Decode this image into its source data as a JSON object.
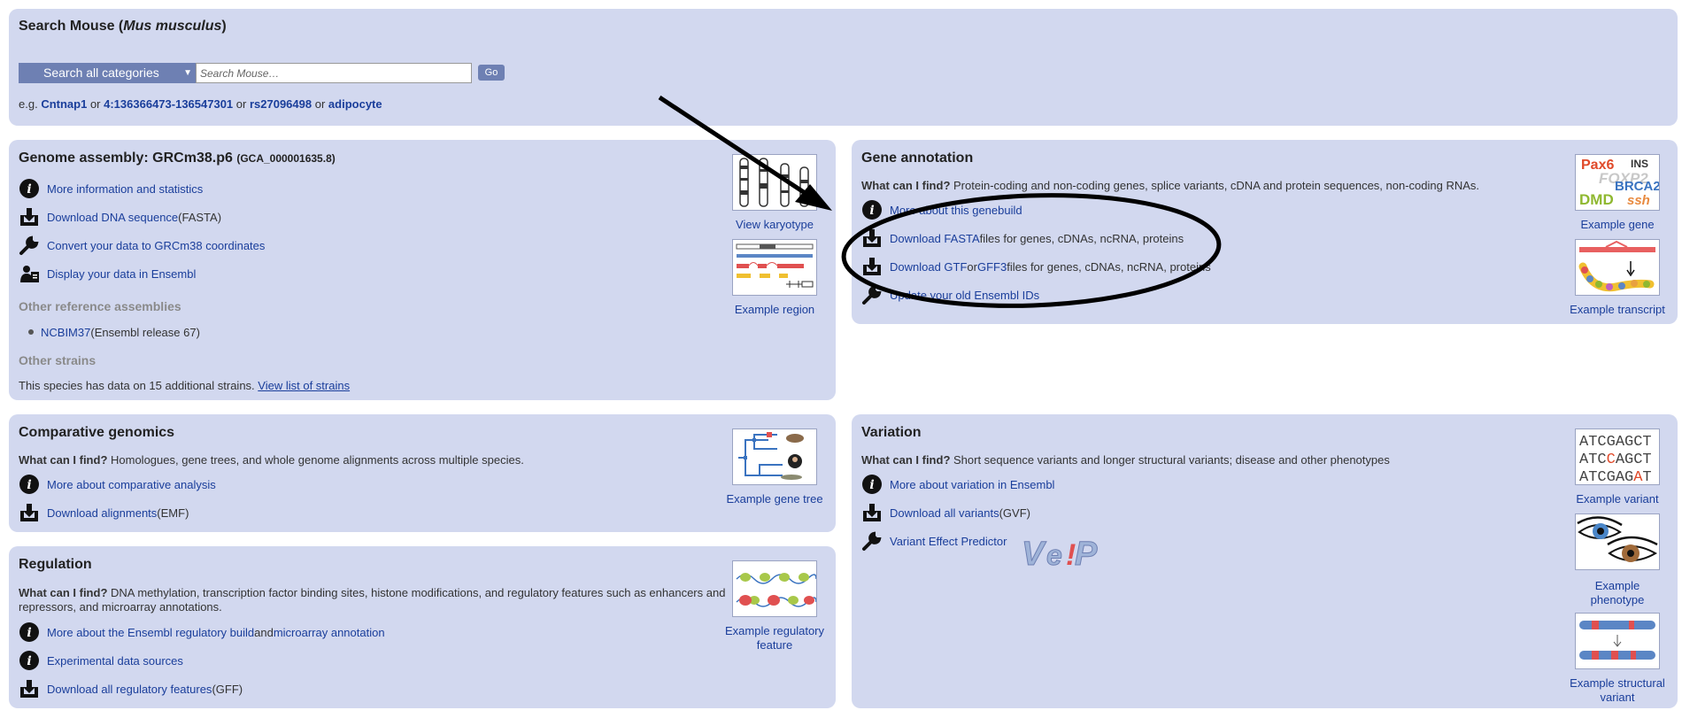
{
  "search": {
    "title_prefix": "Search Mouse (",
    "title_species": "Mus musculus",
    "title_suffix": ")",
    "category_label": "Search all categories",
    "placeholder": "Search Mouse…",
    "go_label": "Go",
    "examples_prefix": "e.g.",
    "examples": [
      "Cntnap1",
      "4:136366473-136547301",
      "rs27096498",
      "adipocyte"
    ],
    "or": "or"
  },
  "assembly": {
    "title": "Genome assembly: GRCm38.p6",
    "accession": "(GCA_000001635.8)",
    "links": [
      {
        "label": "More information and statistics",
        "suffix": ""
      },
      {
        "label": "Download DNA sequence",
        "suffix": " (FASTA)"
      },
      {
        "label": "Convert your data to GRCm38 coordinates",
        "suffix": ""
      },
      {
        "label": "Display your data in Ensembl",
        "suffix": ""
      }
    ],
    "other_ref_heading": "Other reference assemblies",
    "other_ref_link": "NCBIM37",
    "other_ref_suffix": " (Ensembl release 67)",
    "other_strains_heading": "Other strains",
    "strains_text": "This species has data on 15 additional strains.",
    "strains_link": "View list of strains",
    "karyotype_caption": "View karyotype",
    "region_caption": "Example region"
  },
  "gene_annotation": {
    "title": "Gene annotation",
    "what_label": "What can I find?",
    "what_text": " Protein-coding and non-coding genes, splice variants, cDNA and protein sequences, non-coding RNAs.",
    "more_link": "More about this genebuild",
    "download_fasta_link": "Download FASTA",
    "download_fasta_suffix": " files for genes, cDNAs, ncRNA, proteins",
    "download_gtf_link": "Download GTF",
    "or": " or ",
    "gff3_link": "GFF3",
    "download_gtf_suffix": " files for genes, cDNAs, ncRNA, proteins",
    "update_link": "Update your old Ensembl IDs",
    "example_gene_caption": "Example gene",
    "example_transcript_caption": "Example transcript",
    "gene_thumb_words": [
      "Pax6",
      "INS",
      "FOXP2",
      "BRCA2",
      "DMD",
      "ssh"
    ]
  },
  "comparative": {
    "title": "Comparative genomics",
    "what_label": "What can I find?",
    "what_text": " Homologues, gene trees, and whole genome alignments across multiple species.",
    "more_link": "More about comparative analysis",
    "download_link": "Download alignments",
    "download_suffix": " (EMF)",
    "example_caption": "Example gene tree"
  },
  "regulation": {
    "title": "Regulation",
    "what_label": "What can I find?",
    "what_text": " DNA methylation, transcription factor binding sites, histone modifications, and regulatory features such as enhancers and repressors, and microarray annotations.",
    "more_link": "More about the Ensembl regulatory build",
    "and": " and ",
    "microarray_link": "microarray annotation",
    "experimental_link": "Experimental data sources",
    "download_link": "Download all regulatory features",
    "download_suffix": " (GFF)",
    "example_caption_1": "Example regulatory",
    "example_caption_2": "feature"
  },
  "variation": {
    "title": "Variation",
    "what_label": "What can I find?",
    "what_text": " Short sequence variants and longer structural variants; disease and other phenotypes",
    "more_link": "More about variation in Ensembl",
    "download_link": "Download all variants",
    "download_suffix": " (GVF)",
    "vep_link": "Variant Effect Predictor",
    "vep_logo": "VEP",
    "example_variant_caption": "Example variant",
    "example_phenotype_caption_1": "Example",
    "example_phenotype_caption_2": "phenotype",
    "example_sv_caption_1": "Example structural",
    "example_sv_caption_2": "variant",
    "seq_rows": [
      "ATCGAGCT",
      "ATCCAGCT",
      "ATCGAGAT"
    ]
  },
  "colors": {
    "panel_bg": "#d2d8ef",
    "link": "#1a3e9b",
    "button": "#6e80b3",
    "annotation_ink": "#000000"
  }
}
